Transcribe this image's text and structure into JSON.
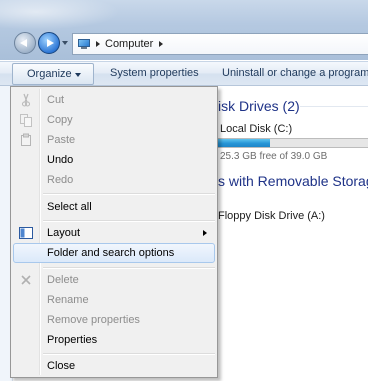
{
  "address_bar": {
    "location": "Computer"
  },
  "toolbar": {
    "organize_label": "Organize",
    "system_properties_label": "System properties",
    "uninstall_label": "Uninstall or change a program"
  },
  "content": {
    "hard_disk_group": "isk Drives (2)",
    "local_disk_label": "Local Disk (C:)",
    "local_disk_free": "25.3 GB free of 39.0 GB",
    "local_disk_used_fraction": 0.35,
    "removable_group": "s with Removable Storage",
    "floppy_label": "Floppy Disk Drive (A:)"
  },
  "organize_menu": {
    "items": [
      {
        "label": "Cut",
        "enabled": false,
        "icon": "scissors-icon"
      },
      {
        "label": "Copy",
        "enabled": false,
        "icon": "copy-icon"
      },
      {
        "label": "Paste",
        "enabled": false,
        "icon": "paste-icon"
      },
      {
        "label": "Undo",
        "enabled": true
      },
      {
        "label": "Redo",
        "enabled": false
      },
      {
        "label": "Select all",
        "enabled": true
      },
      {
        "label": "Layout",
        "enabled": true,
        "icon": "layout-icon",
        "submenu": true
      },
      {
        "label": "Folder and search options",
        "enabled": true,
        "highlighted": true
      },
      {
        "label": "Delete",
        "enabled": false,
        "icon": "delete-icon"
      },
      {
        "label": "Rename",
        "enabled": false
      },
      {
        "label": "Remove properties",
        "enabled": false
      },
      {
        "label": "Properties",
        "enabled": true
      },
      {
        "label": "Close",
        "enabled": true
      }
    ]
  },
  "colors": {
    "group_header": "#1e3287",
    "disk_bar_fill": "#2695d6",
    "highlight_border": "#a8c8ec"
  }
}
